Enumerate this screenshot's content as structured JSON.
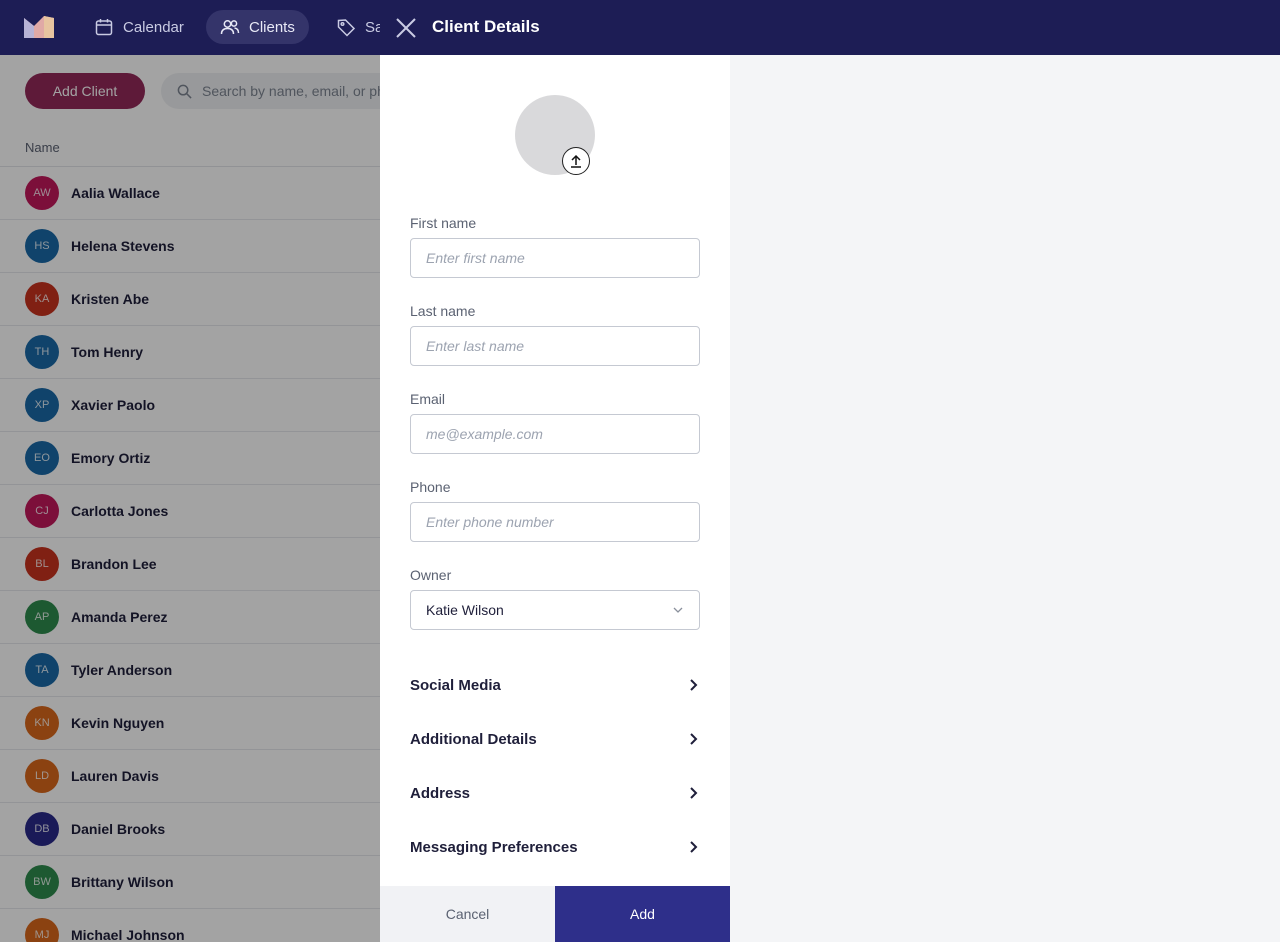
{
  "nav": {
    "items": [
      {
        "label": "Calendar",
        "icon": "calendar-icon"
      },
      {
        "label": "Clients",
        "icon": "users-icon",
        "active": true
      },
      {
        "label": "Sa",
        "icon": "tag-icon"
      }
    ]
  },
  "toolbar": {
    "add_client_label": "Add Client",
    "search_placeholder": "Search by name, email, or ph"
  },
  "table": {
    "column_name": "Name"
  },
  "clients": [
    {
      "initials": "AW",
      "name": "Aalia Wallace",
      "color": "#c2185b"
    },
    {
      "initials": "HS",
      "name": "Helena Stevens",
      "color": "#1a6aa8"
    },
    {
      "initials": "KA",
      "name": "Kristen Abe",
      "color": "#c8321f"
    },
    {
      "initials": "TH",
      "name": "Tom Henry",
      "color": "#1a6aa8"
    },
    {
      "initials": "XP",
      "name": "Xavier Paolo",
      "color": "#1a6aa8"
    },
    {
      "initials": "EO",
      "name": "Emory Ortiz",
      "color": "#1a6aa8"
    },
    {
      "initials": "CJ",
      "name": "Carlotta Jones",
      "color": "#c2185b"
    },
    {
      "initials": "BL",
      "name": "Brandon Lee",
      "color": "#c8321f"
    },
    {
      "initials": "AP",
      "name": "Amanda Perez",
      "color": "#2e8b4e"
    },
    {
      "initials": "TA",
      "name": "Tyler Anderson",
      "color": "#1a6aa8"
    },
    {
      "initials": "KN",
      "name": "Kevin Nguyen",
      "color": "#d9681c"
    },
    {
      "initials": "LD",
      "name": "Lauren Davis",
      "color": "#d9681c"
    },
    {
      "initials": "DB",
      "name": "Daniel Brooks",
      "color": "#2a2a8a"
    },
    {
      "initials": "BW",
      "name": "Brittany Wilson",
      "color": "#2e8b4e"
    },
    {
      "initials": "MJ",
      "name": "Michael Johnson",
      "color": "#d9681c"
    }
  ],
  "drawer": {
    "title": "Client Details",
    "first_name": {
      "label": "First name",
      "placeholder": "Enter first name",
      "value": ""
    },
    "last_name": {
      "label": "Last name",
      "placeholder": "Enter last name",
      "value": ""
    },
    "email": {
      "label": "Email",
      "placeholder": "me@example.com",
      "value": ""
    },
    "phone": {
      "label": "Phone",
      "placeholder": "Enter phone number",
      "value": ""
    },
    "owner": {
      "label": "Owner",
      "value": "Katie Wilson"
    },
    "sections": [
      {
        "label": "Social Media"
      },
      {
        "label": "Additional Details"
      },
      {
        "label": "Address"
      },
      {
        "label": "Messaging Preferences"
      }
    ],
    "cancel_label": "Cancel",
    "add_label": "Add"
  },
  "colors": {
    "header_bg": "#1d1d55",
    "primary_button": "#2e2f8a",
    "add_client_button": "#93295a"
  }
}
